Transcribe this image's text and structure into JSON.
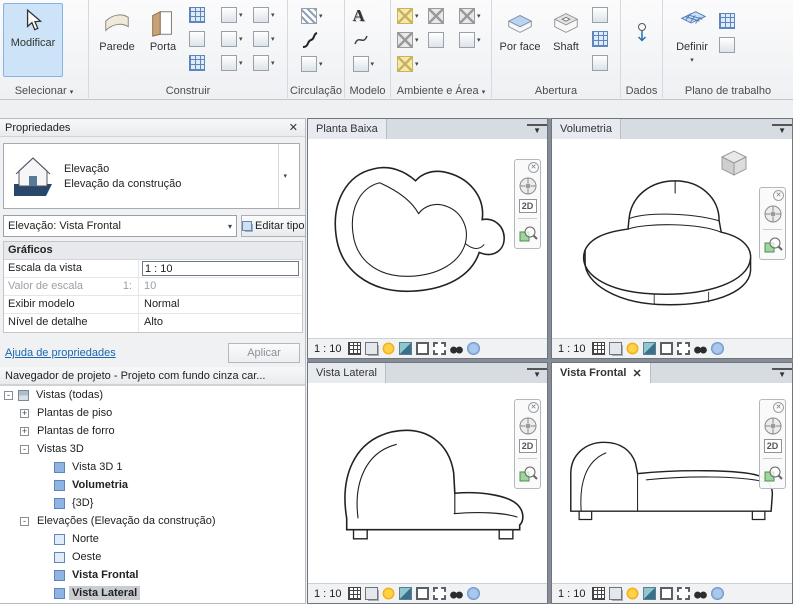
{
  "icons": {
    "close": "✕",
    "dropdown": "▾",
    "view_menu": "▼",
    "nav_2d": "2D",
    "model_text": "A"
  },
  "colors": {
    "modify_highlight": "#cde3f7",
    "link_blue": "#1a66b0",
    "view_icon_blue": "#8fb4e3",
    "sun_yellow": "#ffd24a"
  },
  "ribbon": {
    "groups": [
      {
        "label": "Selecionar"
      },
      {
        "label": "Construir"
      },
      {
        "label": "Circulação"
      },
      {
        "label": "Modelo"
      },
      {
        "label": "Ambiente e Área"
      },
      {
        "label": "Abertura"
      },
      {
        "label": "Dados"
      },
      {
        "label": "Plano de trabalho"
      }
    ],
    "tools": {
      "modificar": "Modificar",
      "parede": "Parede",
      "porta": "Porta",
      "por_face": "Por face",
      "shaft": "Shaft",
      "definir": "Definir"
    }
  },
  "properties": {
    "title": "Propriedades",
    "type_name": "Elevação",
    "type_family": "Elevação da construção",
    "instance": "Elevação: Vista Frontal",
    "edit_type": "Editar tipo",
    "section": "Gráficos",
    "rows": [
      {
        "label": "Escala da vista",
        "value": "1 : 10"
      },
      {
        "label": "Valor de escala",
        "label2": "1:",
        "value": "10"
      },
      {
        "label": "Exibir modelo",
        "value": "Normal"
      },
      {
        "label": "Nível de detalhe",
        "value": "Alto"
      }
    ],
    "help": "Ajuda de propriedades",
    "apply": "Aplicar"
  },
  "browser": {
    "title": "Navegador de projeto - Projeto com fundo cinza car...",
    "tree": [
      {
        "label": "Vistas (todas)",
        "toggle": "-"
      },
      {
        "label": "Plantas de piso",
        "toggle": "+"
      },
      {
        "label": "Plantas de forro",
        "toggle": "+"
      },
      {
        "label": "Vistas 3D",
        "toggle": "-"
      },
      {
        "label": "Vista 3D 1",
        "toggle": ""
      },
      {
        "label": "Volumetria",
        "toggle": ""
      },
      {
        "label": "{3D}",
        "toggle": ""
      },
      {
        "label": "Elevações (Elevação da construção)",
        "toggle": "-"
      },
      {
        "label": "Norte",
        "toggle": ""
      },
      {
        "label": "Oeste",
        "toggle": ""
      },
      {
        "label": "Vista Frontal",
        "toggle": ""
      },
      {
        "label": "Vista Lateral",
        "toggle": ""
      }
    ]
  },
  "viewports": [
    {
      "title": "Planta Baixa",
      "scale": "1 : 10"
    },
    {
      "title": "Volumetria",
      "scale": "1 : 10"
    },
    {
      "title": "Vista Lateral",
      "scale": "1 : 10"
    },
    {
      "title": "Vista Frontal",
      "scale": "1 : 10"
    }
  ]
}
